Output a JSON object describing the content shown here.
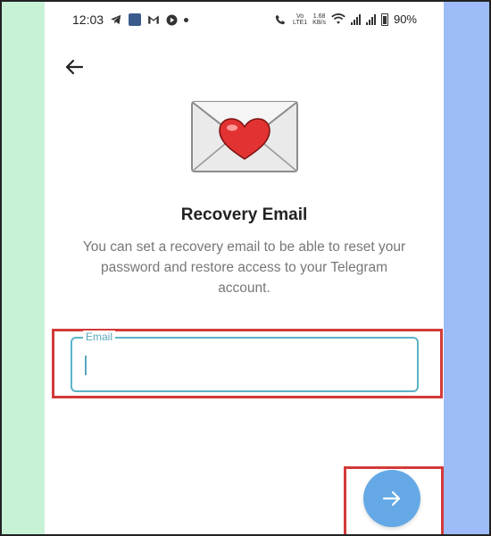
{
  "status_bar": {
    "time": "12:03",
    "volte_badge": "Vo\nLTE1",
    "network_speed_value": "1.68",
    "network_speed_unit": "KB/s",
    "battery": "90%",
    "icons": [
      "telegram-icon",
      "volte-badge-icon",
      "gmail-icon",
      "play-icon",
      "dot-icon",
      "volte-call-icon",
      "wifi-icon",
      "signal-icon",
      "signal-icon",
      "battery-icon"
    ]
  },
  "nav": {
    "back_icon": "arrow-left-icon"
  },
  "illustration": {
    "icon": "envelope-heart-icon",
    "colors": {
      "envelope": "#e9e9e9",
      "heart": "#e23232"
    }
  },
  "content": {
    "title": "Recovery Email",
    "description": "You can set a recovery email to be able to reset your password and restore access to your Telegram account."
  },
  "email_field": {
    "label": "Email",
    "value": "",
    "placeholder": ""
  },
  "next_button": {
    "icon": "arrow-right-icon",
    "color": "#64a9e6"
  },
  "highlight_color": "#d33a3a",
  "colors": {
    "left_strip": "#c8f2d6",
    "right_strip": "#9dbcf7",
    "field_border": "#5cb3c9"
  }
}
